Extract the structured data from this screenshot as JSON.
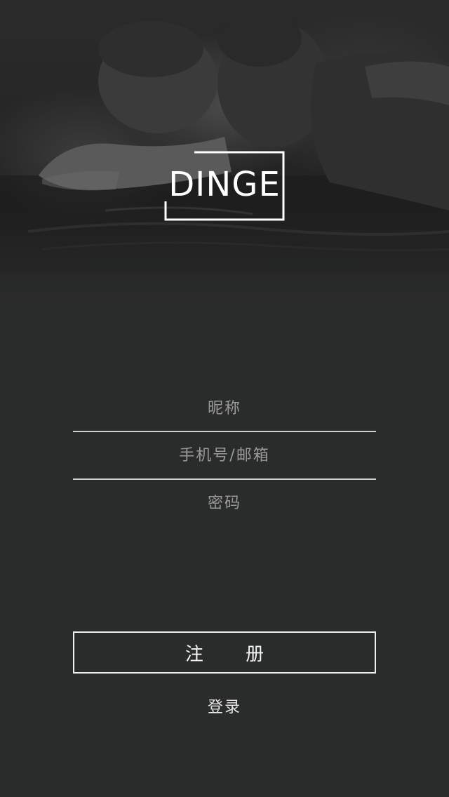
{
  "brand": {
    "logo_text": "DINGE"
  },
  "form": {
    "nickname_placeholder": "昵称",
    "account_placeholder": "手机号/邮箱",
    "password_placeholder": "密码"
  },
  "actions": {
    "register_label": "注 册",
    "login_label": "登录"
  },
  "colors": {
    "background": "#2a2b2b",
    "divider": "#cfcfcf",
    "placeholder": "#9a9a9a",
    "button_border": "#f0f0f0"
  },
  "hero_image": "grayscale-photo-two-people-in-water"
}
